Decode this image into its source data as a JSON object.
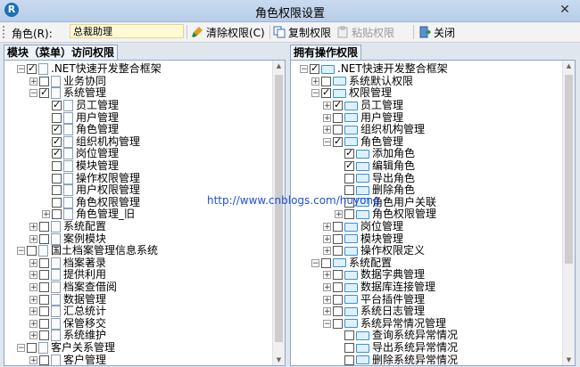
{
  "window": {
    "title": "角色权限设置",
    "icon_letter": "R"
  },
  "toolbar": {
    "role_label": "角色(R):",
    "role_value": "总裁助理",
    "clear_label": "清除权限(C)",
    "copy_label": "复制权限",
    "paste_label": "粘贴权限",
    "close_label": "关闭"
  },
  "left_panel": {
    "title": "模块（菜单）访问权限",
    "rows": [
      {
        "level": 0,
        "exp": "-",
        "cb": true,
        "icon": "doc",
        "label": ".NET快速开发整合框架"
      },
      {
        "level": 1,
        "exp": "+",
        "cb": false,
        "icon": "doc",
        "label": "业务协同"
      },
      {
        "level": 1,
        "exp": "-",
        "cb": true,
        "icon": "doc",
        "label": "系统管理"
      },
      {
        "level": 2,
        "exp": "",
        "cb": true,
        "icon": "doc",
        "label": "员工管理"
      },
      {
        "level": 2,
        "exp": "",
        "cb": false,
        "icon": "doc",
        "label": "用户管理"
      },
      {
        "level": 2,
        "exp": "",
        "cb": true,
        "icon": "doc",
        "label": "角色管理"
      },
      {
        "level": 2,
        "exp": "",
        "cb": true,
        "icon": "doc",
        "label": "组织机构管理"
      },
      {
        "level": 2,
        "exp": "",
        "cb": true,
        "icon": "doc",
        "label": "岗位管理"
      },
      {
        "level": 2,
        "exp": "",
        "cb": false,
        "icon": "doc",
        "label": "模块管理"
      },
      {
        "level": 2,
        "exp": "",
        "cb": false,
        "icon": "doc",
        "label": "操作权限管理"
      },
      {
        "level": 2,
        "exp": "",
        "cb": false,
        "icon": "doc",
        "label": "用户权限管理"
      },
      {
        "level": 2,
        "exp": "",
        "cb": false,
        "icon": "doc",
        "label": "角色权限管理"
      },
      {
        "level": 2,
        "exp": "+",
        "cb": false,
        "icon": "doc",
        "label": "角色管理_旧"
      },
      {
        "level": 1,
        "exp": "+",
        "cb": false,
        "icon": "doc",
        "label": "系统配置"
      },
      {
        "level": 1,
        "exp": "+",
        "cb": false,
        "icon": "doc",
        "label": "案例模块"
      },
      {
        "level": 0,
        "exp": "-",
        "cb": false,
        "icon": "doc",
        "label": "国土档案管理信息系统"
      },
      {
        "level": 1,
        "exp": "+",
        "cb": false,
        "icon": "doc",
        "label": "档案著录"
      },
      {
        "level": 1,
        "exp": "+",
        "cb": false,
        "icon": "doc",
        "label": "提供利用"
      },
      {
        "level": 1,
        "exp": "+",
        "cb": false,
        "icon": "doc",
        "label": "档案查借阅"
      },
      {
        "level": 1,
        "exp": "+",
        "cb": false,
        "icon": "doc",
        "label": "数据管理"
      },
      {
        "level": 1,
        "exp": "+",
        "cb": false,
        "icon": "doc",
        "label": "汇总统计"
      },
      {
        "level": 1,
        "exp": "+",
        "cb": false,
        "icon": "doc",
        "label": "保管移交"
      },
      {
        "level": 1,
        "exp": "+",
        "cb": false,
        "icon": "doc",
        "label": "系统维护"
      },
      {
        "level": 0,
        "exp": "-",
        "cb": false,
        "icon": "doc",
        "label": "客户关系管理"
      },
      {
        "level": 1,
        "exp": "+",
        "cb": false,
        "icon": "doc",
        "label": "客户管理"
      }
    ]
  },
  "right_panel": {
    "title": "拥有操作权限",
    "rows": [
      {
        "level": 0,
        "exp": "-",
        "cb": true,
        "icon": "fold",
        "label": ".NET快速开发整合框架"
      },
      {
        "level": 1,
        "exp": "+",
        "cb": false,
        "icon": "fold",
        "label": "系统默认权限"
      },
      {
        "level": 1,
        "exp": "-",
        "cb": true,
        "icon": "fold",
        "label": "权限管理"
      },
      {
        "level": 2,
        "exp": "+",
        "cb": true,
        "icon": "fold",
        "label": "员工管理"
      },
      {
        "level": 2,
        "exp": "+",
        "cb": false,
        "icon": "fold",
        "label": "用户管理"
      },
      {
        "level": 2,
        "exp": "+",
        "cb": false,
        "icon": "fold",
        "label": "组织机构管理"
      },
      {
        "level": 2,
        "exp": "-",
        "cb": true,
        "icon": "fold",
        "label": "角色管理"
      },
      {
        "level": 3,
        "exp": "",
        "cb": true,
        "icon": "fold",
        "label": "添加角色"
      },
      {
        "level": 3,
        "exp": "",
        "cb": true,
        "icon": "fold",
        "label": "编辑角色"
      },
      {
        "level": 3,
        "exp": "",
        "cb": false,
        "icon": "fold",
        "label": "导出角色"
      },
      {
        "level": 3,
        "exp": "",
        "cb": false,
        "icon": "fold",
        "label": "删除角色"
      },
      {
        "level": 3,
        "exp": "",
        "cb": false,
        "icon": "fold",
        "label": "角色用户关联"
      },
      {
        "level": 3,
        "exp": "+",
        "cb": false,
        "icon": "fold",
        "label": "角色权限管理"
      },
      {
        "level": 2,
        "exp": "+",
        "cb": false,
        "icon": "fold",
        "label": "岗位管理"
      },
      {
        "level": 2,
        "exp": "+",
        "cb": false,
        "icon": "fold",
        "label": "模块管理"
      },
      {
        "level": 2,
        "exp": "+",
        "cb": false,
        "icon": "fold",
        "label": "操作权限定义"
      },
      {
        "level": 1,
        "exp": "-",
        "cb": false,
        "icon": "fold",
        "label": "系统配置"
      },
      {
        "level": 2,
        "exp": "+",
        "cb": false,
        "icon": "fold",
        "label": "数据字典管理"
      },
      {
        "level": 2,
        "exp": "+",
        "cb": false,
        "icon": "fold",
        "label": "数据库连接管理"
      },
      {
        "level": 2,
        "exp": "+",
        "cb": false,
        "icon": "fold",
        "label": "平台插件管理"
      },
      {
        "level": 2,
        "exp": "+",
        "cb": false,
        "icon": "fold",
        "label": "系统日志管理"
      },
      {
        "level": 2,
        "exp": "-",
        "cb": false,
        "icon": "fold",
        "label": "系统异常情况管理"
      },
      {
        "level": 3,
        "exp": "",
        "cb": false,
        "icon": "fold",
        "label": "查询系统异常情况"
      },
      {
        "level": 3,
        "exp": "",
        "cb": false,
        "icon": "fold",
        "label": "导出系统异常情况"
      },
      {
        "level": 3,
        "exp": "",
        "cb": false,
        "icon": "fold",
        "label": "删除系统异常情况"
      }
    ]
  },
  "watermark": "http://www.cnblogs.com/huyong"
}
